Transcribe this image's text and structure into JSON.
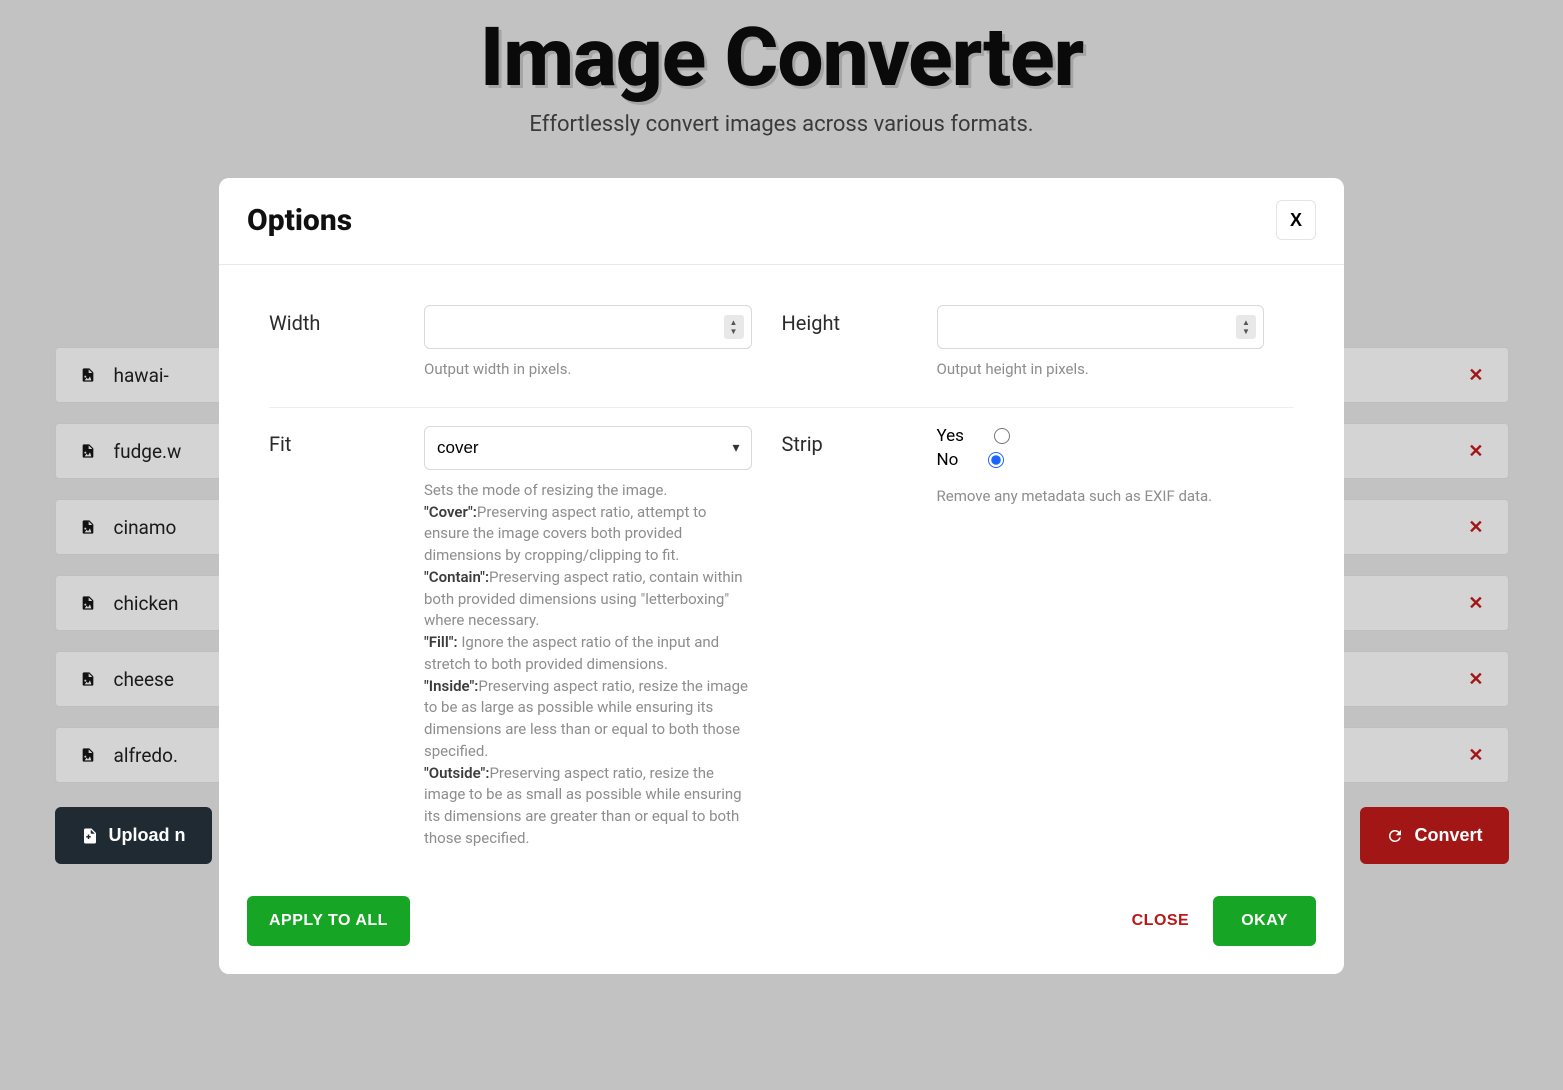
{
  "header": {
    "title": "Image Converter",
    "subtitle": "Effortlessly convert images across various formats."
  },
  "files": [
    {
      "name": "hawai-"
    },
    {
      "name": "fudge.w"
    },
    {
      "name": "cinamo"
    },
    {
      "name": "chicken"
    },
    {
      "name": "cheese"
    },
    {
      "name": "alfredo."
    }
  ],
  "buttons": {
    "upload": "Upload n",
    "convert": "Convert"
  },
  "modal": {
    "title": "Options",
    "close_x": "X",
    "width": {
      "label": "Width",
      "value": "",
      "help": "Output width in pixels."
    },
    "height": {
      "label": "Height",
      "value": "",
      "help": "Output height in pixels."
    },
    "fit": {
      "label": "Fit",
      "value": "cover",
      "options": [
        "cover",
        "contain",
        "fill",
        "inside",
        "outside"
      ],
      "help_intro": "Sets the mode of resizing the image.",
      "help_items": [
        {
          "k": "\"Cover\":",
          "v": "Preserving aspect ratio, attempt to ensure the image covers both provided dimensions by cropping/clipping to fit."
        },
        {
          "k": "\"Contain\":",
          "v": "Preserving aspect ratio, contain within both provided dimensions using \"letterboxing\" where necessary."
        },
        {
          "k": "\"Fill\":",
          "v": " Ignore the aspect ratio of the input and stretch to both provided dimensions."
        },
        {
          "k": "\"Inside\":",
          "v": "Preserving aspect ratio, resize the image to be as large as possible while ensuring its dimensions are less than or equal to both those specified."
        },
        {
          "k": "\"Outside\":",
          "v": "Preserving aspect ratio, resize the image to be as small as possible while ensuring its dimensions are greater than or equal to both those specified."
        }
      ]
    },
    "strip": {
      "label": "Strip",
      "yes": "Yes",
      "no": "No",
      "selected": "no",
      "help": "Remove any metadata such as EXIF data."
    },
    "footer": {
      "apply_all": "APPLY TO ALL",
      "close": "CLOSE",
      "okay": "OKAY"
    }
  }
}
